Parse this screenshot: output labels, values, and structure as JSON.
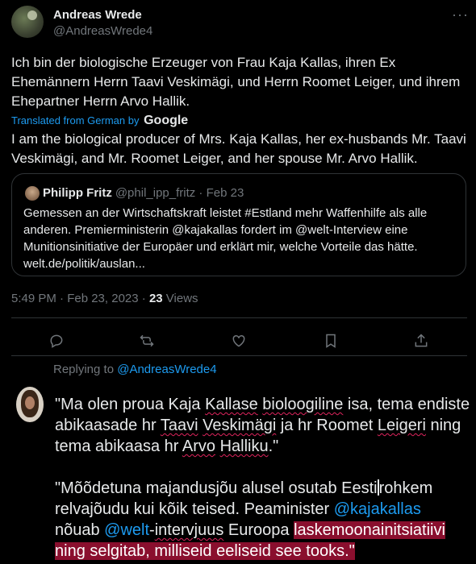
{
  "author": {
    "name": "Andreas Wrede",
    "handle": "@AndreasWrede4"
  },
  "tweet": {
    "text": "Ich bin der biologische Erzeuger von Frau Kaja Kallas, ihren Ex Ehemännern Herrn Taavi Veskimägi, und Herrn Roomet Leiger, und ihrem Ehepartner Herrn Arvo Hallik.",
    "translated_label": "Translated from German by",
    "translated_by": "Google",
    "translation": "I am the biological producer of Mrs. Kaja Kallas, her ex-husbands Mr. Taavi Veskimägi, and Mr. Roomet Leiger, and her spouse Mr. Arvo Hallik.",
    "time": "5:49 PM · Feb 23, 2023 · ",
    "views_count": "23",
    "views_label": " Views"
  },
  "quote": {
    "name": "Philipp Fritz",
    "meta": "@phil_ipp_fritz · Feb 23",
    "text": "Gemessen an der Wirtschaftskraft leistet #Estland mehr Waffenhilfe als alle anderen. Premierministerin @kajakallas fordert im @welt-Interview eine Munitionsinitiative der Europäer und erklärt mir, welche Vorteile das hätte. welt.de/politik/auslan..."
  },
  "replying": {
    "prefix": "Replying to ",
    "handle": "@AndreasWrede4"
  },
  "reply": {
    "p1": {
      "a": "\"Ma olen proua Kaja ",
      "b": "Kallase",
      "c": " ",
      "d": "bioloogiline",
      "e": " isa, tema endiste abikaasade hr ",
      "f": "Taavi",
      "g": " ",
      "h": "Veskimägi",
      "i": " ja hr Roomet ",
      "j": "Leigeri",
      "k": " ning tema abikaasa hr ",
      "l": "Arvo",
      "m": " ",
      "n": "Halliku",
      "o": ".\""
    },
    "p2": {
      "a": "\"Mõõdetuna majandusjõu alusel osutab Eesti",
      "b": "rohkem relvajõudu kui kõik teised. Peaminister ",
      "c": "@kajakallas",
      "d": " nõuab ",
      "e": "@welt",
      "f": "-",
      "g": "intervjuus",
      "h": " Euroopa ",
      "i": "laskemoonainitsiatiivi ning selgitab, milliseid eeliseid see tooks.\""
    },
    "highlight_color": "#8a0f2e"
  },
  "icons": [
    "more-icon",
    "reply-icon",
    "retweet-icon",
    "like-icon",
    "bookmark-icon",
    "share-icon"
  ]
}
